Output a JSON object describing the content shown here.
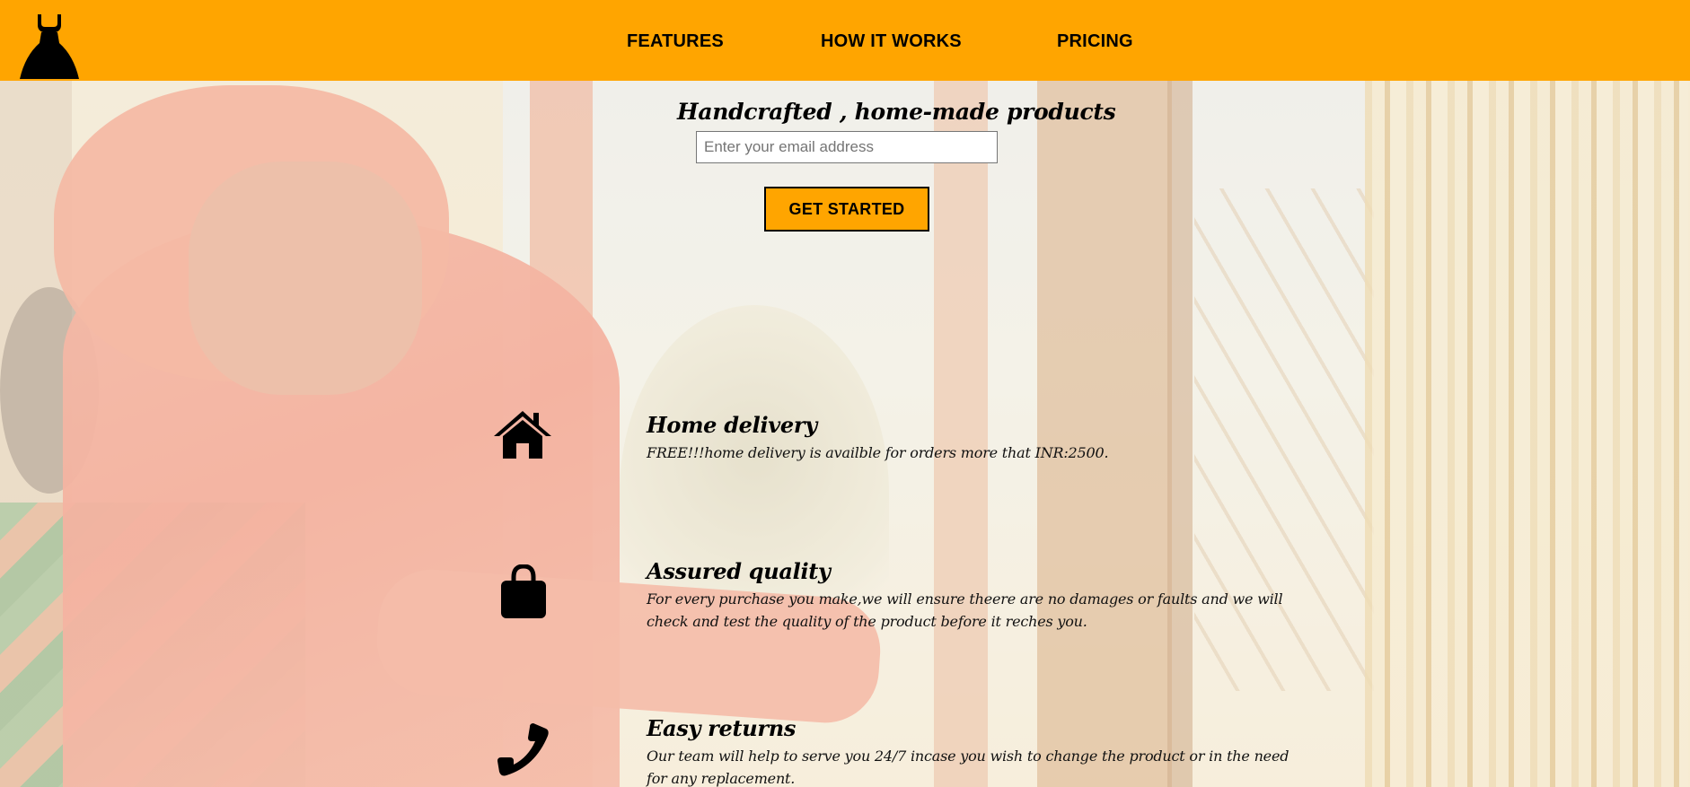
{
  "colors": {
    "accent": "#ffa500",
    "text": "#000000"
  },
  "header": {
    "logo_icon": "dress-icon",
    "nav": [
      {
        "label": "FEATURES"
      },
      {
        "label": "HOW IT WORKS"
      },
      {
        "label": "PRICING"
      }
    ]
  },
  "hero": {
    "title": "Handcrafted , home-made products",
    "email_placeholder": "Enter your email address",
    "email_value": "",
    "cta_label": "GET STARTED"
  },
  "features": [
    {
      "icon": "home-icon",
      "title": "Home delivery",
      "description": "FREE!!!home delivery is availble for orders more that INR:2500."
    },
    {
      "icon": "shopping-bag-icon",
      "title": "Assured quality",
      "description": "For every purchase you make,we will ensure theere are no damages or faults and we will check and test the quality of the product before it reches you."
    },
    {
      "icon": "phone-icon",
      "title": "Easy returns",
      "description": "Our team will help to serve you 24/7 incase you wish to change the product or in the need for any replacement."
    }
  ]
}
